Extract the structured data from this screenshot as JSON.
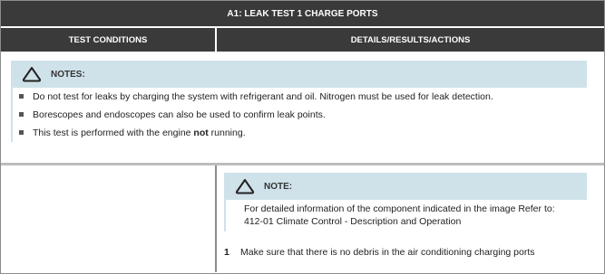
{
  "title": "A1: LEAK TEST 1 CHARGE PORTS",
  "headers": {
    "left": "TEST CONDITIONS",
    "right": "DETAILS/RESULTS/ACTIONS"
  },
  "notes": {
    "icon": "warning-triangle-icon",
    "title": "NOTES:",
    "items": [
      {
        "text": "Do not test for leaks by charging the system with refrigerant and oil. Nitrogen must be used for leak detection."
      },
      {
        "text": "Borescopes and endoscopes can also be used to confirm leak points."
      },
      {
        "pre": "This test is performed with the engine ",
        "bold": "not",
        "post": " running."
      }
    ]
  },
  "note": {
    "icon": "warning-triangle-icon",
    "title": "NOTE:",
    "line1": "For detailed information of the component indicated in the image Refer to:",
    "line2": "412-01 Climate Control - Description and Operation"
  },
  "step": {
    "number": "1",
    "text": "Make sure that there is no debris in the air conditioning charging ports"
  },
  "colors": {
    "header_bg": "#3a3a3a",
    "note_bg": "#cfe2ea"
  }
}
